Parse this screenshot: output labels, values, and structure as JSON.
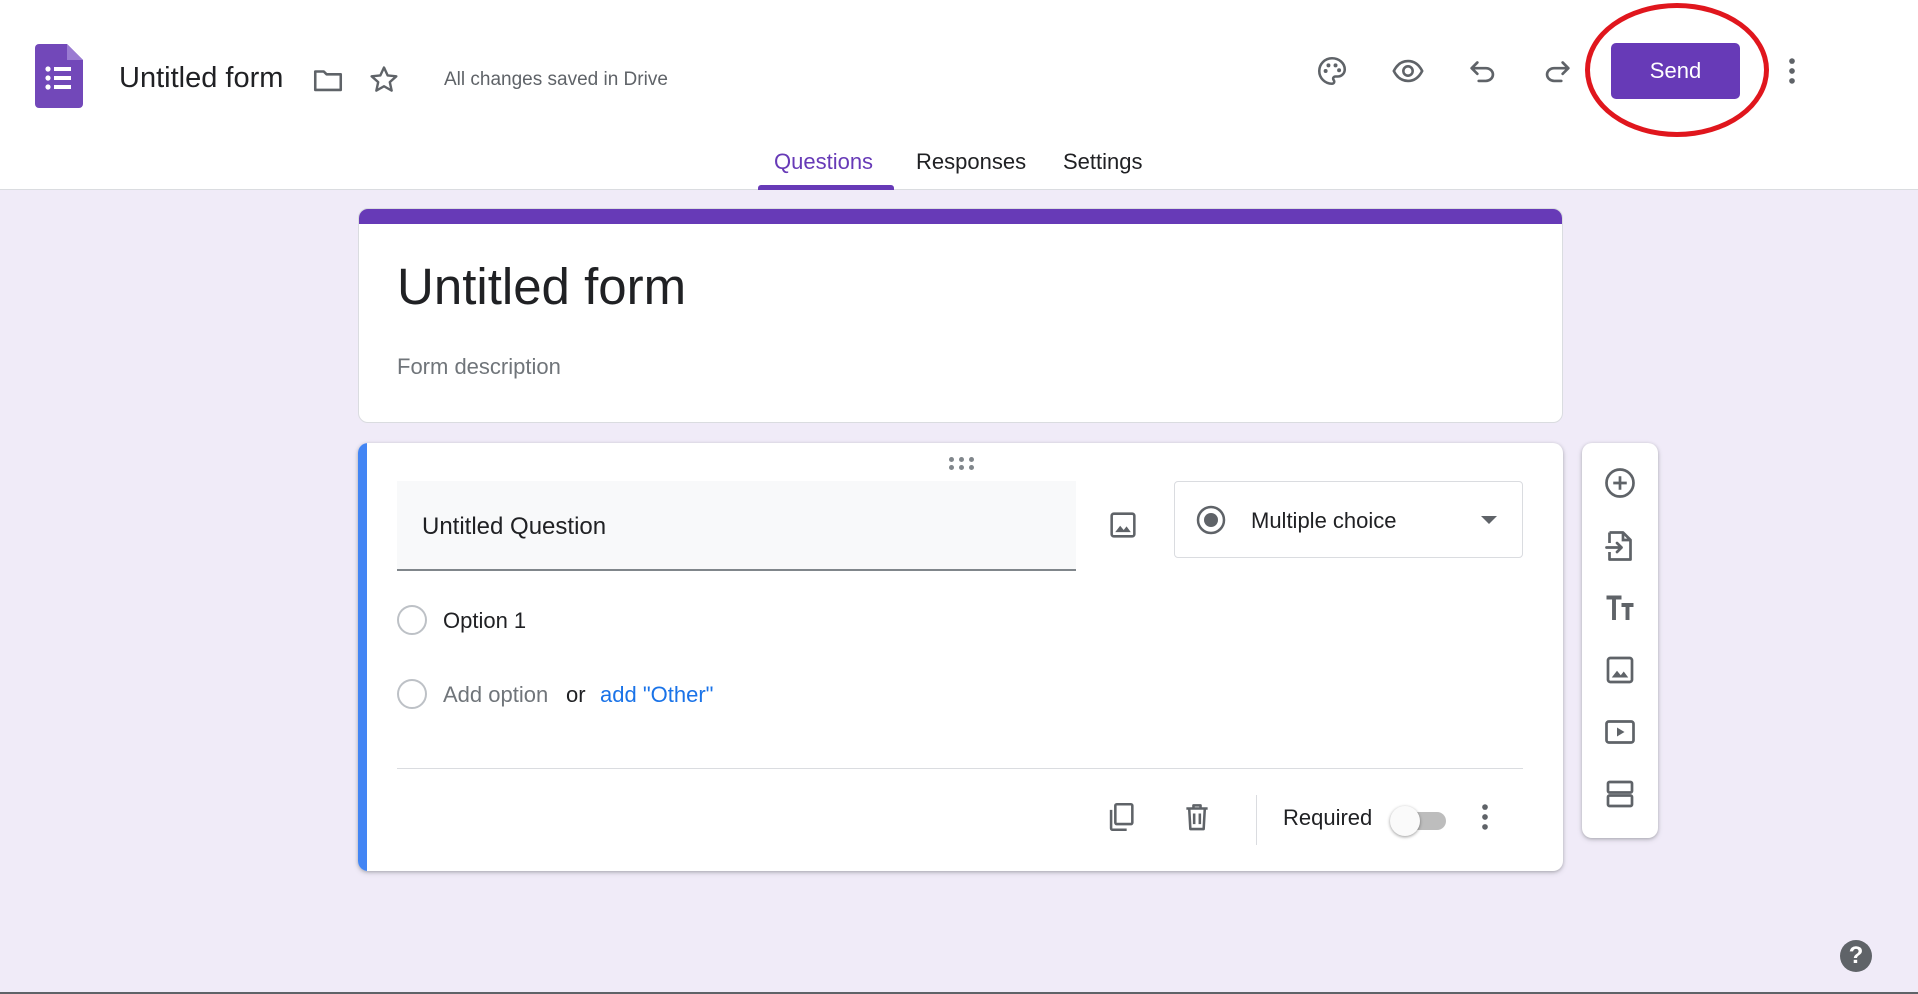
{
  "header": {
    "form_title": "Untitled form",
    "save_status": "All changes saved in Drive",
    "send_label": "Send"
  },
  "icons": {
    "logo": "google-forms-logo-icon",
    "folder": "folder-icon",
    "star": "star-icon",
    "palette": "palette-icon",
    "preview": "eye-icon",
    "undo": "undo-icon",
    "redo": "redo-icon",
    "more": "more-vert-icon"
  },
  "tabs": [
    {
      "label": "Questions",
      "active": true
    },
    {
      "label": "Responses",
      "active": false
    },
    {
      "label": "Settings",
      "active": false
    }
  ],
  "title_card": {
    "heading": "Untitled form",
    "description_placeholder": "Form description"
  },
  "question": {
    "title": "Untitled Question",
    "type": "Multiple choice",
    "options": [
      {
        "label": "Option 1"
      }
    ],
    "add_option": "Add option",
    "or": "or",
    "add_other": "add \"Other\"",
    "required_label": "Required",
    "required": false
  },
  "side_toolbar": [
    "add-question-icon",
    "import-questions-icon",
    "add-title-icon",
    "add-image-icon",
    "add-video-icon",
    "add-section-icon"
  ],
  "help": "?",
  "colors": {
    "brand": "#673ab7",
    "background": "#f0ebf8",
    "active_question_bar": "#4285f4",
    "link": "#1a73e8",
    "highlight": "#e0161d"
  }
}
